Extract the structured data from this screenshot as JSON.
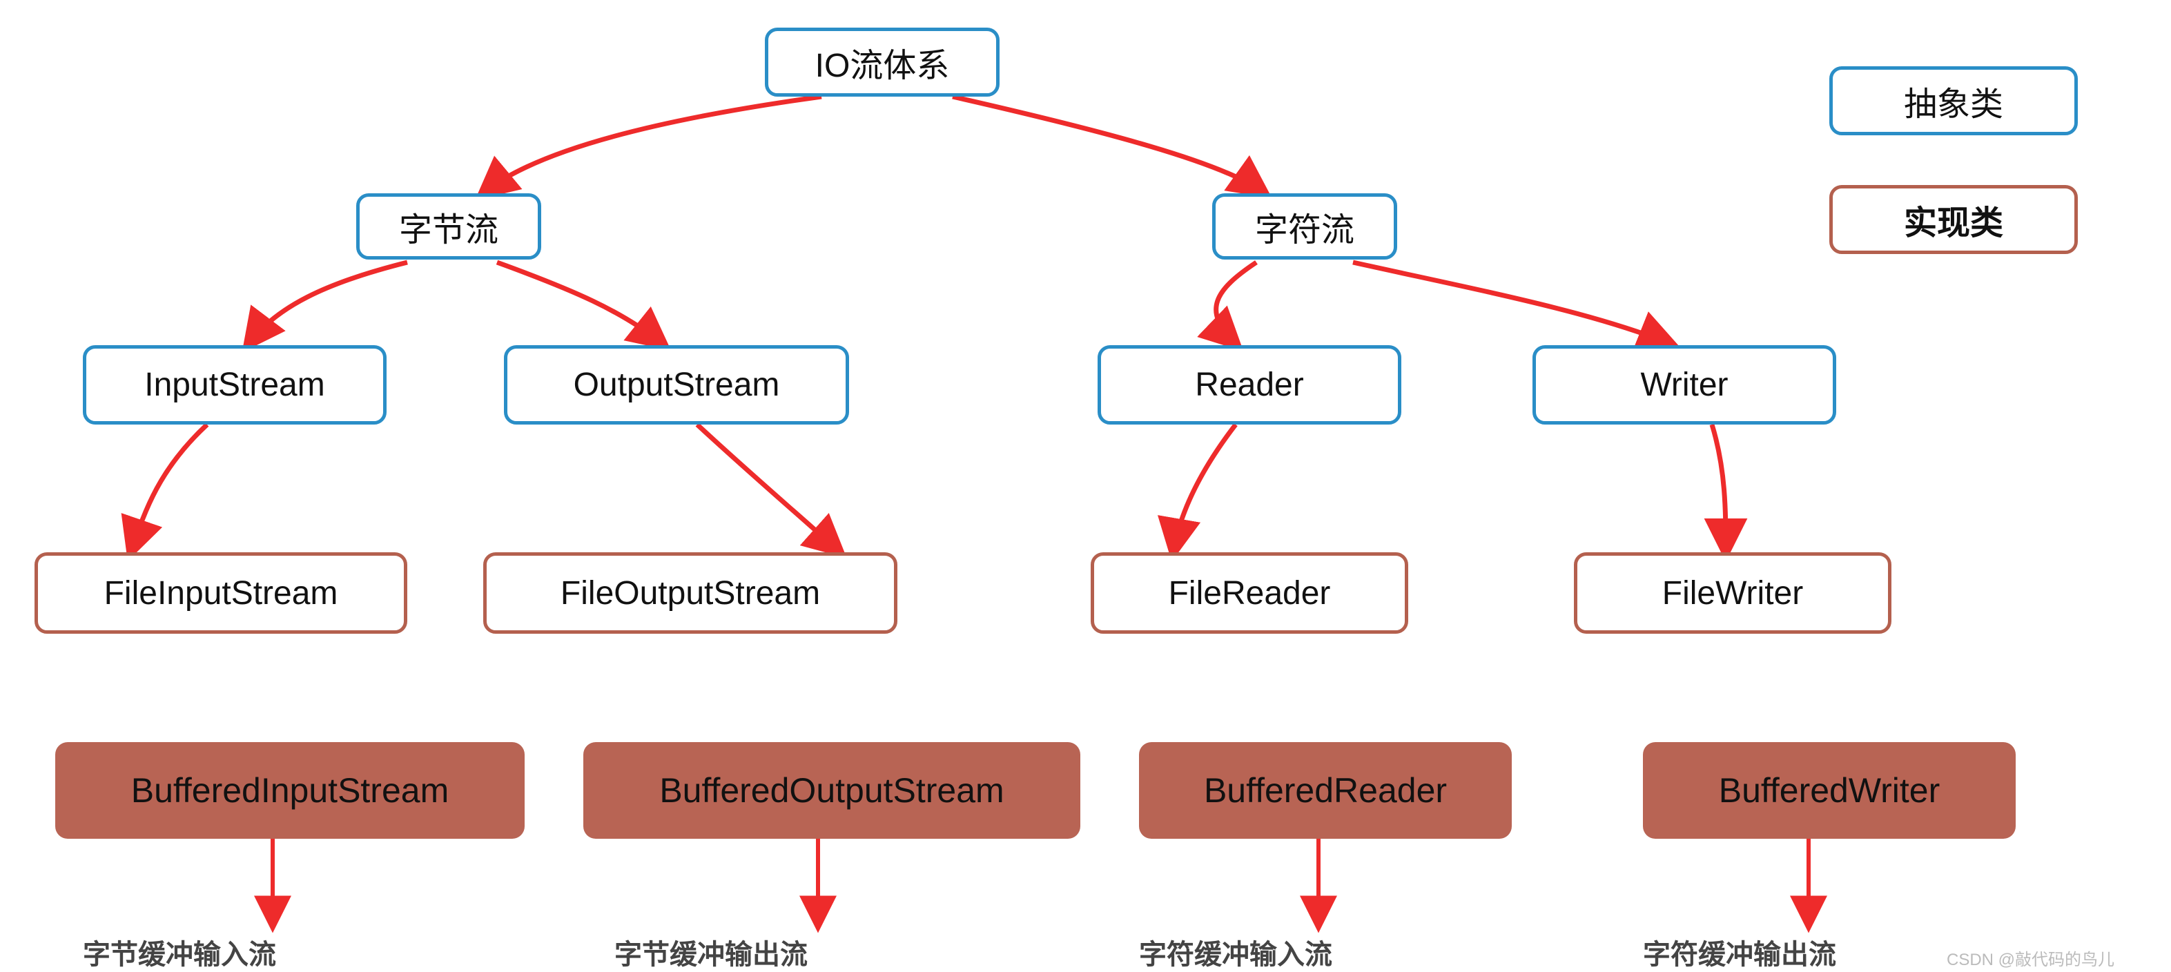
{
  "colors": {
    "abstract_border": "#2a8ec7",
    "impl_border": "#b4604e",
    "solid_fill": "#b86454",
    "arrow": "#ee2b2b"
  },
  "legend": {
    "abstract": "抽象类",
    "impl": "实现类"
  },
  "root": {
    "label": "IO流体系"
  },
  "byte_stream": {
    "label": "字节流"
  },
  "char_stream": {
    "label": "字符流"
  },
  "input_stream": {
    "label": "InputStream"
  },
  "output_stream": {
    "label": "OutputStream"
  },
  "reader": {
    "label": "Reader"
  },
  "writer": {
    "label": "Writer"
  },
  "file_input_stream": {
    "label": "FileInputStream"
  },
  "file_output_stream": {
    "label": "FileOutputStream"
  },
  "file_reader": {
    "label": "FileReader"
  },
  "file_writer": {
    "label": "FileWriter"
  },
  "buffered_input_stream": {
    "label": "BufferedInputStream",
    "desc": "字节缓冲输入流"
  },
  "buffered_output_stream": {
    "label": "BufferedOutputStream",
    "desc": "字节缓冲输出流"
  },
  "buffered_reader": {
    "label": "BufferedReader",
    "desc": "字符缓冲输入流"
  },
  "buffered_writer": {
    "label": "BufferedWriter",
    "desc": "字符缓冲输出流"
  },
  "watermark": "CSDN @敲代码的鸟儿"
}
